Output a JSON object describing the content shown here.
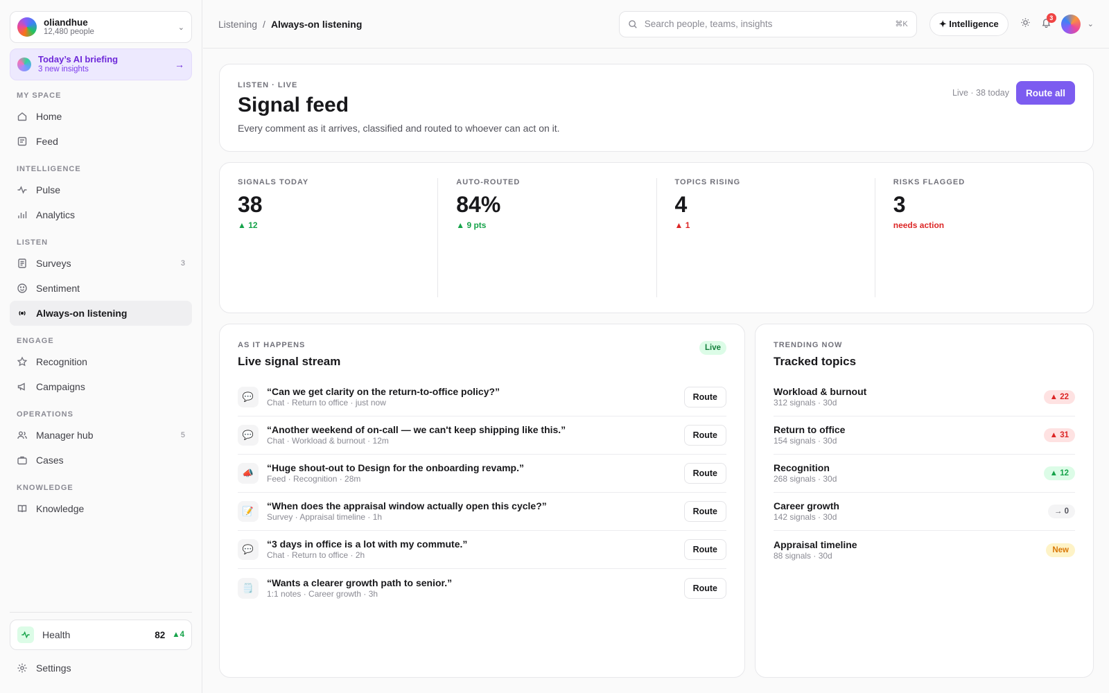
{
  "org": {
    "name": "oliandhue",
    "count": "12,480 people"
  },
  "briefing": {
    "title": "Today’s AI briefing",
    "subtitle": "3 new insights"
  },
  "nav": {
    "my_space": {
      "label": "MY SPACE",
      "items": [
        {
          "label": "Home"
        },
        {
          "label": "Feed"
        }
      ]
    },
    "intelligence": {
      "label": "INTELLIGENCE",
      "items": [
        {
          "label": "Pulse"
        },
        {
          "label": "Analytics"
        }
      ]
    },
    "listen": {
      "label": "LISTEN",
      "items": [
        {
          "label": "Surveys",
          "badge": "3"
        },
        {
          "label": "Sentiment"
        },
        {
          "label": "Always-on listening"
        }
      ]
    },
    "engage": {
      "label": "ENGAGE",
      "items": [
        {
          "label": "Recognition"
        },
        {
          "label": "Campaigns"
        }
      ]
    },
    "operations": {
      "label": "OPERATIONS",
      "items": [
        {
          "label": "Manager hub",
          "badge": "5"
        },
        {
          "label": "Cases"
        }
      ]
    },
    "knowledge": {
      "label": "KNOWLEDGE",
      "items": [
        {
          "label": "Knowledge"
        }
      ]
    }
  },
  "health": {
    "label": "Health",
    "score": "82",
    "delta": "▲4"
  },
  "settings_label": "Settings",
  "breadcrumb": {
    "parent": "Listening",
    "separator": "/",
    "current": "Always-on listening"
  },
  "search": {
    "placeholder": "Search people, teams, insights",
    "shortcut": "⌘K"
  },
  "intelligence_button": "✦ Intelligence",
  "notifications_count": "3",
  "hero": {
    "eyebrow": "LISTEN · LIVE",
    "title": "Signal feed",
    "description": "Every comment as it arrives, classified and routed to whoever can act on it.",
    "status": "Live · 38 today",
    "route_all": "Route all"
  },
  "stats": [
    {
      "label": "SIGNALS TODAY",
      "value": "38",
      "delta": "▲ 12",
      "trend": "up"
    },
    {
      "label": "AUTO-ROUTED",
      "value": "84%",
      "delta": "▲ 9 pts",
      "trend": "up"
    },
    {
      "label": "TOPICS RISING",
      "value": "4",
      "delta": "▲ 1",
      "trend": "down"
    },
    {
      "label": "RISKS FLAGGED",
      "value": "3",
      "delta": "needs action",
      "trend": "down"
    }
  ],
  "stream": {
    "eyebrow": "AS IT HAPPENS",
    "title": "Live signal stream",
    "live_label": "Live",
    "route_label": "Route",
    "items": [
      {
        "icon": "💬",
        "quote": "“Can we get clarity on the return-to-office policy?”",
        "meta": "Chat · Return to office · just now"
      },
      {
        "icon": "💬",
        "quote": "“Another weekend of on-call — we can't keep shipping like this.”",
        "meta": "Chat · Workload & burnout · 12m"
      },
      {
        "icon": "📣",
        "quote": "“Huge shout-out to Design for the onboarding revamp.”",
        "meta": "Feed · Recognition · 28m"
      },
      {
        "icon": "📝",
        "quote": "“When does the appraisal window actually open this cycle?”",
        "meta": "Survey · Appraisal timeline · 1h"
      },
      {
        "icon": "💬",
        "quote": "“3 days in office is a lot with my commute.”",
        "meta": "Chat · Return to office · 2h"
      },
      {
        "icon": "🗒️",
        "quote": "“Wants a clearer growth path to senior.”",
        "meta": "1:1 notes · Career growth · 3h"
      }
    ]
  },
  "topics": {
    "eyebrow": "TRENDING NOW",
    "title": "Tracked topics",
    "items": [
      {
        "name": "Workload & burnout",
        "meta": "312 signals · 30d",
        "pill": "▲ 22",
        "tone": "red"
      },
      {
        "name": "Return to office",
        "meta": "154 signals · 30d",
        "pill": "▲ 31",
        "tone": "red"
      },
      {
        "name": "Recognition",
        "meta": "268 signals · 30d",
        "pill": "▲ 12",
        "tone": "green"
      },
      {
        "name": "Career growth",
        "meta": "142 signals · 30d",
        "pill": "→ 0",
        "tone": "gray"
      },
      {
        "name": "Appraisal timeline",
        "meta": "88 signals · 30d",
        "pill": "New",
        "tone": "amber"
      }
    ]
  },
  "colors": {
    "accent": "#7c5cf0",
    "positive": "#16a34a",
    "negative": "#dc2626",
    "warning": "#d97706"
  }
}
